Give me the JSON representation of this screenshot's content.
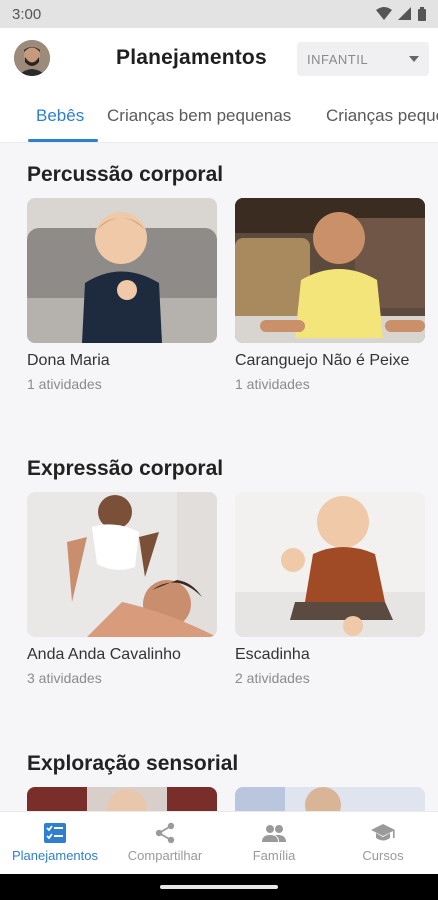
{
  "status_bar": {
    "time": "3:00"
  },
  "header": {
    "title": "Planejamentos",
    "level_select": {
      "value": "INFANTIL"
    }
  },
  "tabs": [
    {
      "label": "Bebês",
      "active": true
    },
    {
      "label": "Crianças bem pequenas",
      "active": false
    },
    {
      "label": "Crianças pequenas",
      "active": false
    }
  ],
  "sections": [
    {
      "title": "Percussão corporal",
      "cards": [
        {
          "title": "Dona Maria",
          "count": "1 atividades"
        },
        {
          "title": "Caranguejo Não é Peixe",
          "count": "1 atividades"
        }
      ]
    },
    {
      "title": "Expressão corporal",
      "cards": [
        {
          "title": "Anda Anda Cavalinho",
          "count": "3 atividades"
        },
        {
          "title": "Escadinha",
          "count": "2 atividades"
        }
      ]
    },
    {
      "title": "Exploração sensorial",
      "cards": []
    }
  ],
  "bottom_nav": [
    {
      "label": "Planejamentos",
      "icon": "checklist-icon",
      "active": true
    },
    {
      "label": "Compartilhar",
      "icon": "share-icon",
      "active": false
    },
    {
      "label": "Família",
      "icon": "people-icon",
      "active": false
    },
    {
      "label": "Cursos",
      "icon": "graduation-cap-icon",
      "active": false
    }
  ],
  "colors": {
    "accent": "#2f7fd0",
    "background": "#f6f6f8",
    "inactive": "#9a9a9a"
  }
}
